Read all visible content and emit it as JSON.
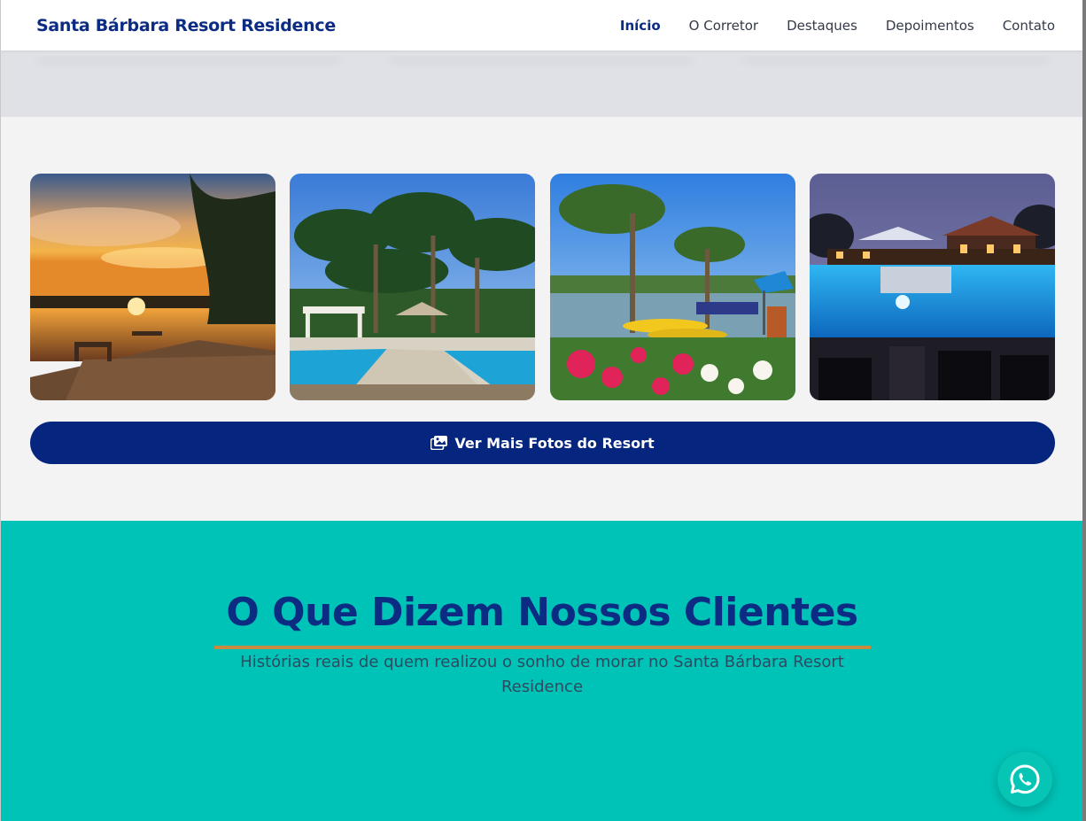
{
  "header": {
    "brand": "Santa Bárbara Resort Residence",
    "nav": [
      {
        "label": "Início",
        "active": true
      },
      {
        "label": "O Corretor",
        "active": false
      },
      {
        "label": "Destaques",
        "active": false
      },
      {
        "label": "Depoimentos",
        "active": false
      },
      {
        "label": "Contato",
        "active": false
      }
    ]
  },
  "gallery": {
    "photos": [
      {
        "name": "sunset-lake-deck-photo"
      },
      {
        "name": "palm-trees-pool-photo"
      },
      {
        "name": "lake-kayaks-flowers-photo"
      },
      {
        "name": "night-pool-clubhouse-photo"
      }
    ],
    "more_button": {
      "label": "Ver Mais Fotos do Resort",
      "icon": "images-icon"
    }
  },
  "testimonials": {
    "title": "O Que Dizem Nossos Clientes",
    "subtitle": "Histórias reais de quem realizou o sonho de morar no Santa Bárbara Resort Residence"
  },
  "whatsapp": {
    "icon": "whatsapp-icon"
  },
  "colors": {
    "brand_navy": "#06257e",
    "teal": "#00c3b7",
    "accent_gold": "#c88a3f"
  }
}
